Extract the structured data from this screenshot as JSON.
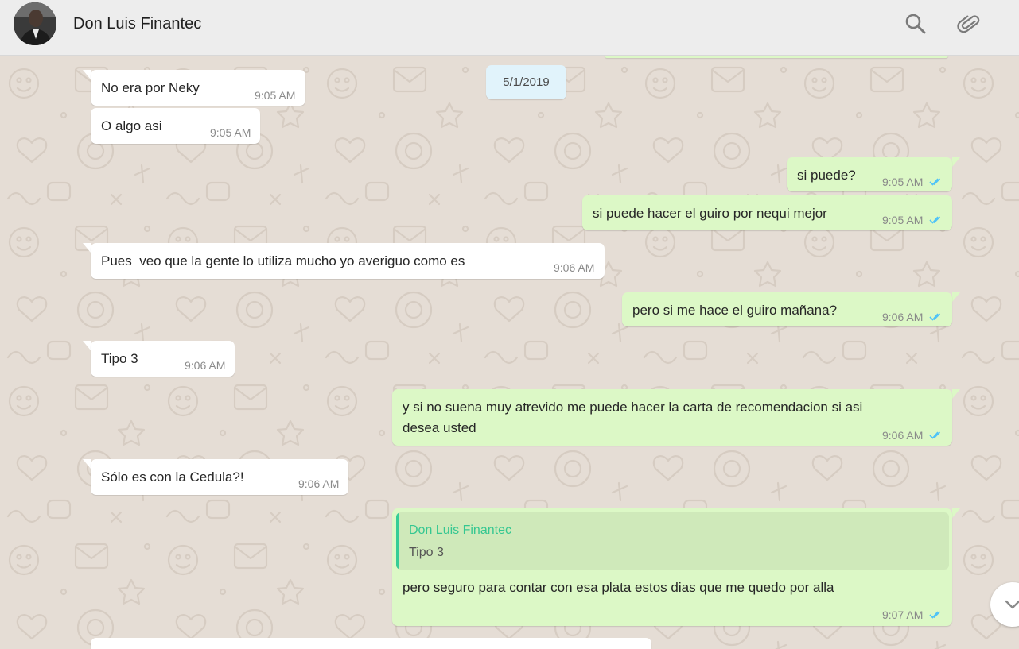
{
  "header": {
    "contact_name": "Don Luis Finantec",
    "icons": {
      "search": "search-icon",
      "attach": "paperclip-icon"
    }
  },
  "chat": {
    "date_separator": "5/1/2019",
    "messages": [
      {
        "dir": "in",
        "text": "No era por Neky",
        "time": "9:05 AM"
      },
      {
        "dir": "in",
        "text": "O algo asi",
        "time": "9:05 AM"
      },
      {
        "dir": "out",
        "text": "si puede?",
        "time": "9:05 AM",
        "status": "read"
      },
      {
        "dir": "out",
        "text": "si puede hacer el guiro por nequi mejor",
        "time": "9:05 AM",
        "status": "read"
      },
      {
        "dir": "in",
        "text": "Pues  veo que la gente lo utiliza mucho yo averiguo como es",
        "time": "9:06 AM"
      },
      {
        "dir": "out",
        "text": "pero si me hace el guiro mañana?",
        "time": "9:06 AM",
        "status": "read"
      },
      {
        "dir": "in",
        "text": "Tipo 3",
        "time": "9:06 AM"
      },
      {
        "dir": "out",
        "text_line1": "y si no suena muy atrevido me puede hacer la carta de recomendacion si asi",
        "text_line2": "desea usted",
        "time": "9:06 AM",
        "status": "read"
      },
      {
        "dir": "in",
        "text": "Sólo es con la Cedula?!",
        "time": "9:06 AM"
      },
      {
        "dir": "out",
        "reply_to": {
          "name": "Don Luis Finantec",
          "text": "Tipo 3"
        },
        "text": "pero seguro para contar con esa plata estos dias que me quedo por alla",
        "time": "9:07 AM",
        "status": "read"
      }
    ]
  },
  "colors": {
    "incoming": "#ffffff",
    "outgoing": "#dcf8c6",
    "read_ticks": "#4fc3f7",
    "reply_accent": "#35cd96",
    "wallpaper": "#e5ddd5"
  }
}
